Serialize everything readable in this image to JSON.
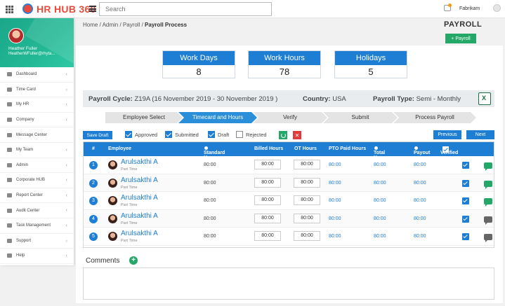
{
  "app": {
    "title": "HR HUB 360",
    "tenant": "Fabrikam"
  },
  "search": {
    "placeholder": "Search"
  },
  "user": {
    "name": "Heather Fuller",
    "email": "HeatherWFuller@rhyta..."
  },
  "sidebar": {
    "items": [
      {
        "label": "Dashboard"
      },
      {
        "label": "Time Card"
      },
      {
        "label": "My HR"
      },
      {
        "label": "Company"
      },
      {
        "label": "Message Center"
      },
      {
        "label": "My Team"
      },
      {
        "label": "Admin"
      },
      {
        "label": "Corporate HUB"
      },
      {
        "label": "Report Center"
      },
      {
        "label": "Audit Center"
      },
      {
        "label": "Task Management"
      },
      {
        "label": "Support"
      },
      {
        "label": "Help"
      }
    ]
  },
  "breadcrumb": {
    "trail": "Home / Admin / Payroll / ",
    "current": "Payroll Process"
  },
  "page": {
    "title": "PAYROLL",
    "add_button": "+ Payroll"
  },
  "stats": [
    {
      "label": "Work Days",
      "value": "8"
    },
    {
      "label": "Work Hours",
      "value": "78"
    },
    {
      "label": "Holidays",
      "value": "5"
    }
  ],
  "cycle": {
    "cycle_label": "Payroll Cycle:",
    "cycle_value": "Z19A (16 November 2019 - 30 November 2019 )",
    "country_label": "Country:",
    "country_value": "USA",
    "type_label": "Payroll Type:",
    "type_value": "Semi - Monthly"
  },
  "steps": [
    {
      "label": "Employee Select",
      "active": false
    },
    {
      "label": "Timecard and Hours",
      "active": true
    },
    {
      "label": "Verify",
      "active": false
    },
    {
      "label": "Submit",
      "active": false
    },
    {
      "label": "Process Payroll",
      "active": false
    }
  ],
  "toolbar": {
    "save_draft": "Save Draft",
    "filters": [
      {
        "label": "Approved",
        "checked": true
      },
      {
        "label": "Submitted",
        "checked": true
      },
      {
        "label": "Draft",
        "checked": true
      },
      {
        "label": "Rejected",
        "checked": false
      }
    ],
    "reject_symbol": "✕",
    "previous": "Previous",
    "next": "Next"
  },
  "table": {
    "headers": {
      "num": "#",
      "employee": "Employee",
      "standard_hours": "Standard Hours",
      "billed_hours": "Billed Hours",
      "ot_hours": "OT Hours",
      "pto_paid_hours": "PTO Paid Hours",
      "total_hours": "Total Hours",
      "payout": "Payout",
      "verified": "Verified"
    },
    "rows": [
      {
        "num": "1",
        "name": "Arulsakthi A",
        "type": "Part Time",
        "standard": "80:00",
        "billed": "80:00",
        "ot": "80:00",
        "pto": "80:00",
        "total": "80:00",
        "payout": "80:00",
        "verified": true,
        "comment_color": "green"
      },
      {
        "num": "2",
        "name": "Arulsakthi A",
        "type": "Part Time",
        "standard": "80:00",
        "billed": "80:00",
        "ot": "80:00",
        "pto": "80:00",
        "total": "80:00",
        "payout": "80:00",
        "verified": true,
        "comment_color": "green"
      },
      {
        "num": "3",
        "name": "Arulsakthi A",
        "type": "Part Time",
        "standard": "80:00",
        "billed": "80:00",
        "ot": "80:00",
        "pto": "80:00",
        "total": "80:00",
        "payout": "80:00",
        "verified": true,
        "comment_color": "green"
      },
      {
        "num": "4",
        "name": "Arulsakthi A",
        "type": "Part Time",
        "standard": "80:00",
        "billed": "80:00",
        "ot": "80:00",
        "pto": "80:00",
        "total": "80:00",
        "payout": "80:00",
        "verified": true,
        "comment_color": "gray"
      },
      {
        "num": "5",
        "name": "Arulsakthi A",
        "type": "Part Time",
        "standard": "80:00",
        "billed": "80:00",
        "ot": "80:00",
        "pto": "80:00",
        "total": "80:00",
        "payout": "80:00",
        "verified": true,
        "comment_color": "gray"
      }
    ]
  },
  "comments": {
    "label": "Comments",
    "add_symbol": "+"
  },
  "colors": {
    "primary": "#1e7ed4",
    "success": "#24a868",
    "danger": "#e03a3a",
    "brand": "#e84b3c",
    "sidebar_header": "#1aa789"
  }
}
